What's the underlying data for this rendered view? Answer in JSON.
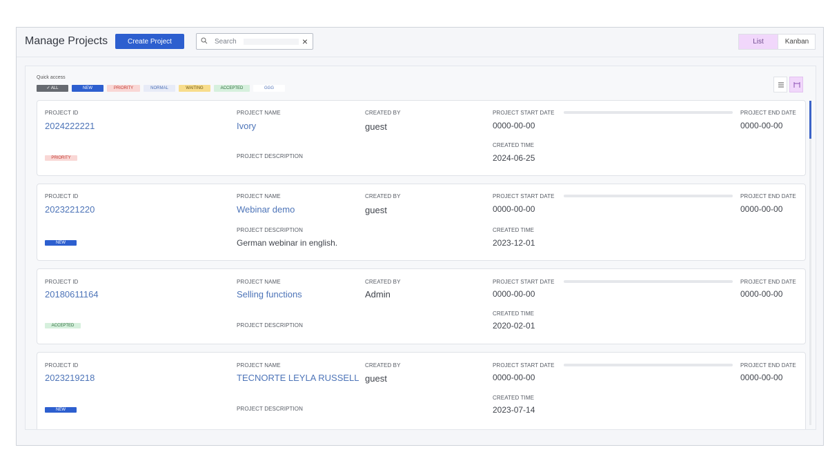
{
  "header": {
    "title": "Manage Projects",
    "create_label": "Create Project",
    "search_placeholder": "Search",
    "clear_symbol": "×",
    "views": [
      "List",
      "Kanban"
    ],
    "active_view": "List"
  },
  "quick_access": {
    "label": "Quick access",
    "chips": [
      {
        "label": "✓  ALL",
        "bg": "#666a70",
        "fg": "#ffffff"
      },
      {
        "label": "NEW",
        "bg": "#2d5fcf",
        "fg": "#ffffff"
      },
      {
        "label": "PRIORITY",
        "bg": "#f9d7d5",
        "fg": "#c33b33"
      },
      {
        "label": "NORMAL",
        "bg": "#e7ebf7",
        "fg": "#4d70b6"
      },
      {
        "label": "WAITING",
        "bg": "#f8dd8c",
        "fg": "#6c5511"
      },
      {
        "label": "ACCEPTED",
        "bg": "#d6f0dd",
        "fg": "#296a39"
      },
      {
        "label": "GGG",
        "bg": "#ffffff",
        "fg": "#4d70b6"
      }
    ]
  },
  "labels": {
    "project_id": "PROJECT ID",
    "project_name": "PROJECT NAME",
    "created_by": "CREATED BY",
    "start_date": "PROJECT START DATE",
    "end_date": "PROJECT END DATE",
    "description": "PROJECT DESCRIPTION",
    "created_time": "CREATED TIME"
  },
  "projects": [
    {
      "id": "2024222221",
      "name": "Ivory",
      "created_by": "guest",
      "start_date": "0000-00-00",
      "end_date": "0000-00-00",
      "description": "",
      "created_time": "2024-06-25",
      "status": "PRIORITY",
      "status_bg": "#f9d7d5",
      "status_fg": "#c33b33"
    },
    {
      "id": "2023221220",
      "name": "Webinar demo",
      "created_by": "guest",
      "start_date": "0000-00-00",
      "end_date": "0000-00-00",
      "description": "German webinar in english.",
      "created_time": "2023-12-01",
      "status": "NEW",
      "status_bg": "#2d5fcf",
      "status_fg": "#ffffff"
    },
    {
      "id": "20180611164",
      "name": "Selling functions",
      "created_by": "Admin",
      "start_date": "0000-00-00",
      "end_date": "0000-00-00",
      "description": "",
      "created_time": "2020-02-01",
      "status": "ACCEPTED",
      "status_bg": "#d6f0dd",
      "status_fg": "#296a39"
    },
    {
      "id": "2023219218",
      "name": "TECNORTE LEYLA RUSSELL",
      "created_by": "guest",
      "start_date": "0000-00-00",
      "end_date": "0000-00-00",
      "description": "",
      "created_time": "2023-07-14",
      "status": "NEW",
      "status_bg": "#2d5fcf",
      "status_fg": "#ffffff"
    }
  ]
}
